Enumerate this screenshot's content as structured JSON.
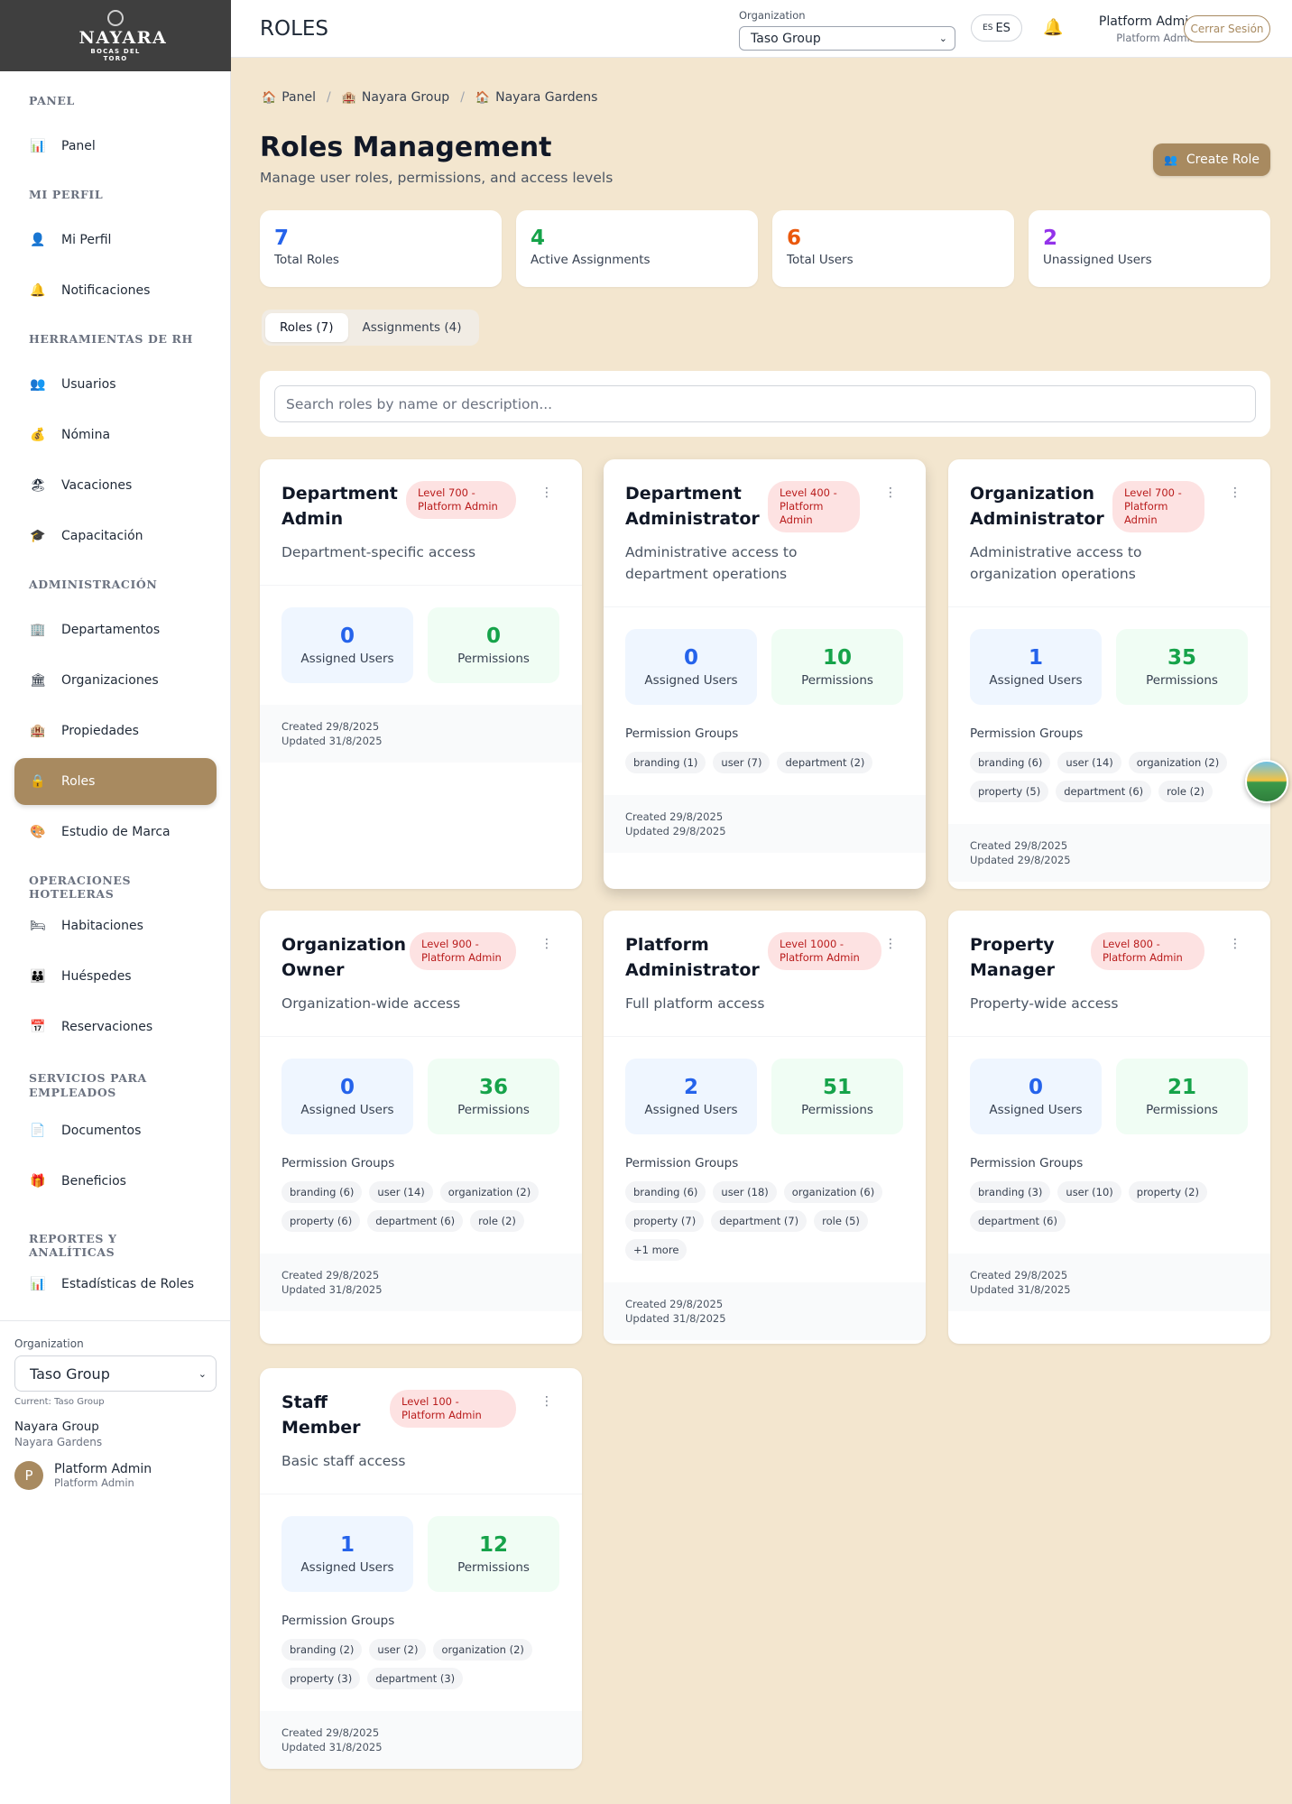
{
  "brand": {
    "name": "NAYARA",
    "sub": "BOCAS DEL TORO"
  },
  "header": {
    "title": "ROLES",
    "org_label": "Organization",
    "org_value": "Taso Group",
    "lang_flag": "ES",
    "lang": "ES",
    "user_name": "Platform Admin",
    "user_role": "Platform Admin",
    "logout": "Cerrar Sesión"
  },
  "sidebar": {
    "sections": [
      {
        "label": "Panel",
        "items": [
          {
            "label": "Panel",
            "icon": "chart-icon",
            "glyph": "📊"
          }
        ]
      },
      {
        "label": "Mi Perfil",
        "items": [
          {
            "label": "Mi Perfil",
            "icon": "user-icon",
            "glyph": "👤"
          },
          {
            "label": "Notificaciones",
            "icon": "bell-icon",
            "glyph": "🔔"
          }
        ]
      },
      {
        "label": "Herramientas de RH",
        "items": [
          {
            "label": "Usuarios",
            "icon": "users-icon",
            "glyph": "👥"
          },
          {
            "label": "Nómina",
            "icon": "money-bag-icon",
            "glyph": "💰"
          },
          {
            "label": "Vacaciones",
            "icon": "beach-icon",
            "glyph": "🏖"
          },
          {
            "label": "Capacitación",
            "icon": "graduation-cap-icon",
            "glyph": "🎓"
          }
        ]
      },
      {
        "label": "Administración",
        "items": [
          {
            "label": "Departamentos",
            "icon": "building-icon",
            "glyph": "🏢"
          },
          {
            "label": "Organizaciones",
            "icon": "bank-icon",
            "glyph": "🏛"
          },
          {
            "label": "Propiedades",
            "icon": "hotel-icon",
            "glyph": "🏨"
          },
          {
            "label": "Roles",
            "icon": "lock-icon",
            "glyph": "🔒",
            "active": true
          },
          {
            "label": "Estudio de Marca",
            "icon": "palette-icon",
            "glyph": "🎨"
          }
        ]
      },
      {
        "label": "Operaciones Hoteleras",
        "items": [
          {
            "label": "Habitaciones",
            "icon": "bed-icon",
            "glyph": "🛏"
          },
          {
            "label": "Huéspedes",
            "icon": "family-icon",
            "glyph": "👪"
          },
          {
            "label": "Reservaciones",
            "icon": "calendar-icon",
            "glyph": "📅"
          }
        ]
      },
      {
        "label": "Servicios para Empleados",
        "items": [
          {
            "label": "Documentos",
            "icon": "document-icon",
            "glyph": "📄"
          },
          {
            "label": "Beneficios",
            "icon": "gift-icon",
            "glyph": "🎁"
          }
        ]
      },
      {
        "label": "Reportes y Analíticas",
        "items": [
          {
            "label": "Estadísticas de Roles",
            "icon": "chart-icon",
            "glyph": "📊"
          }
        ]
      }
    ],
    "org_label": "Organization",
    "org_value": "Taso Group",
    "current": "Current: Taso Group",
    "group": "Nayara Group",
    "group_sub": "Nayara Gardens",
    "avatar_initial": "P",
    "user_name": "Platform Admin",
    "user_role": "Platform Admin"
  },
  "breadcrumb": [
    {
      "label": "Panel",
      "icon": "home-icon",
      "glyph": "🏠"
    },
    {
      "label": "Nayara Group",
      "icon": "hotel-icon",
      "glyph": "🏨"
    },
    {
      "label": "Nayara Gardens",
      "icon": "home-icon",
      "glyph": "🏠"
    }
  ],
  "page": {
    "title": "Roles Management",
    "subtitle": "Manage user roles, permissions, and access levels",
    "create_button": "Create Role",
    "search_placeholder": "Search roles by name or description..."
  },
  "stats": [
    {
      "value": "7",
      "label": "Total Roles",
      "color": "#2563eb"
    },
    {
      "value": "4",
      "label": "Active Assignments",
      "color": "#16a34a"
    },
    {
      "value": "6",
      "label": "Total Users",
      "color": "#ea580c"
    },
    {
      "value": "2",
      "label": "Unassigned Users",
      "color": "#9333ea"
    }
  ],
  "tabs": [
    {
      "label": "Roles (7)",
      "active": true
    },
    {
      "label": "Assignments (4)"
    }
  ],
  "labels": {
    "assigned_users": "Assigned Users",
    "permissions": "Permissions",
    "permission_groups": "Permission Groups"
  },
  "roles": [
    {
      "name": "Department Admin",
      "level": "Level 700 - Platform Admin",
      "description": "Department-specific access",
      "assigned": "0",
      "permissions": "0",
      "groups": [],
      "created": "Created 29/8/2025",
      "updated": "Updated 31/8/2025"
    },
    {
      "name": "Department Administrator",
      "level": "Level 400 - Platform Admin",
      "description": "Administrative access to department operations",
      "assigned": "0",
      "permissions": "10",
      "groups": [
        "branding (1)",
        "user (7)",
        "department (2)"
      ],
      "created": "Created 29/8/2025",
      "updated": "Updated 29/8/2025"
    },
    {
      "name": "Organization Administrator",
      "level": "Level 700 - Platform Admin",
      "description": "Administrative access to organization operations",
      "assigned": "1",
      "permissions": "35",
      "groups": [
        "branding (6)",
        "user (14)",
        "organization (2)",
        "property (5)",
        "department (6)",
        "role (2)"
      ],
      "created": "Created 29/8/2025",
      "updated": "Updated 29/8/2025"
    },
    {
      "name": "Organization Owner",
      "level": "Level 900 - Platform Admin",
      "description": "Organization-wide access",
      "assigned": "0",
      "permissions": "36",
      "groups": [
        "branding (6)",
        "user (14)",
        "organization (2)",
        "property (6)",
        "department (6)",
        "role (2)"
      ],
      "created": "Created 29/8/2025",
      "updated": "Updated 31/8/2025"
    },
    {
      "name": "Platform Administrator",
      "level": "Level 1000 - Platform Admin",
      "description": "Full platform access",
      "assigned": "2",
      "permissions": "51",
      "groups": [
        "branding (6)",
        "user (18)",
        "organization (6)",
        "property (7)",
        "department (7)",
        "role (5)",
        "+1 more"
      ],
      "created": "Created 29/8/2025",
      "updated": "Updated 31/8/2025"
    },
    {
      "name": "Property Manager",
      "level": "Level 800 - Platform Admin",
      "description": "Property-wide access",
      "assigned": "0",
      "permissions": "21",
      "groups": [
        "branding (3)",
        "user (10)",
        "property (2)",
        "department (6)"
      ],
      "created": "Created 29/8/2025",
      "updated": "Updated 31/8/2025"
    },
    {
      "name": "Staff Member",
      "level": "Level 100 - Platform Admin",
      "description": "Basic staff access",
      "assigned": "1",
      "permissions": "12",
      "groups": [
        "branding (2)",
        "user (2)",
        "organization (2)",
        "property (3)",
        "department (3)"
      ],
      "created": "Created 29/8/2025",
      "updated": "Updated 31/8/2025"
    }
  ]
}
